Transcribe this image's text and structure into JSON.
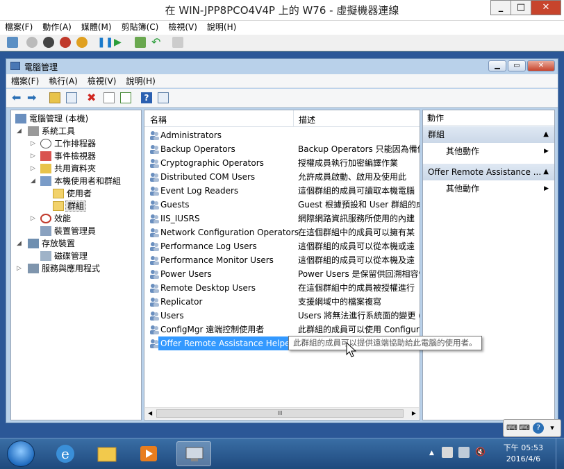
{
  "vm": {
    "title": "在 WIN-JPP8PCO4V4P 上的 W76 - 虛擬機器連線",
    "menu": [
      "檔案(F)",
      "動作(A)",
      "媒體(M)",
      "剪貼簿(C)",
      "檢視(V)",
      "說明(H)"
    ]
  },
  "mmc": {
    "title": "電腦管理",
    "menu": [
      "檔案(F)",
      "執行(A)",
      "檢視(V)",
      "說明(H)"
    ]
  },
  "tree": {
    "root": "電腦管理 (本機)",
    "system_tools": "系統工具",
    "task_scheduler": "工作排程器",
    "event_viewer": "事件檢視器",
    "shared_folders": "共用資料夾",
    "local_users_groups": "本機使用者和群組",
    "users": "使用者",
    "groups": "群組",
    "performance": "效能",
    "device_manager": "裝置管理員",
    "storage": "存放裝置",
    "disk_management": "磁碟管理",
    "services_apps": "服務與應用程式"
  },
  "list": {
    "col_name": "名稱",
    "col_desc": "描述",
    "rows": [
      {
        "name": "Administrators",
        "desc": ""
      },
      {
        "name": "Backup Operators",
        "desc": "Backup Operators 只能因為備份"
      },
      {
        "name": "Cryptographic Operators",
        "desc": "授權成員執行加密編譯作業"
      },
      {
        "name": "Distributed COM Users",
        "desc": "允許成員啟動、啟用及使用此"
      },
      {
        "name": "Event Log Readers",
        "desc": "這個群組的成員可讀取本機電腦"
      },
      {
        "name": "Guests",
        "desc": "Guest 根據預設和 User 群組的成"
      },
      {
        "name": "IIS_IUSRS",
        "desc": "網際網路資訊服務所使用的內建"
      },
      {
        "name": "Network Configuration Operators",
        "desc": "在這個群組中的成員可以擁有某"
      },
      {
        "name": "Performance Log Users",
        "desc": "這個群組的成員可以從本機或遠"
      },
      {
        "name": "Performance Monitor Users",
        "desc": "這個群組的成員可以從本機及遠"
      },
      {
        "name": "Power Users",
        "desc": "Power Users 是保留供回溯相容性"
      },
      {
        "name": "Remote Desktop Users",
        "desc": "在這個群組中的成員被授權進行"
      },
      {
        "name": "Replicator",
        "desc": "支援網域中的檔案複寫"
      },
      {
        "name": "Users",
        "desc": "Users 將無法進行系統面的變更 (."
      },
      {
        "name": "ConfigMgr 遠端控制使用者",
        "desc": "此群組的成員可以使用 Configura"
      },
      {
        "name": "Offer Remote Assistance Helpers",
        "desc": ""
      }
    ],
    "tooltip": "此群組的成員可以提供遠端協助給此電腦的使用者。",
    "scroll_glyph": "III"
  },
  "actions": {
    "header": "動作",
    "section1": "群組",
    "section1_item": "其他動作",
    "section2": "Offer Remote Assistance ...",
    "section2_item": "其他動作"
  },
  "taskbar": {
    "time": "下午 05:53",
    "date": "2016/4/6"
  },
  "colors": {
    "selection": "#3399ff",
    "title_band": "#b9d1ea",
    "taskbar": "#2a5e96"
  }
}
